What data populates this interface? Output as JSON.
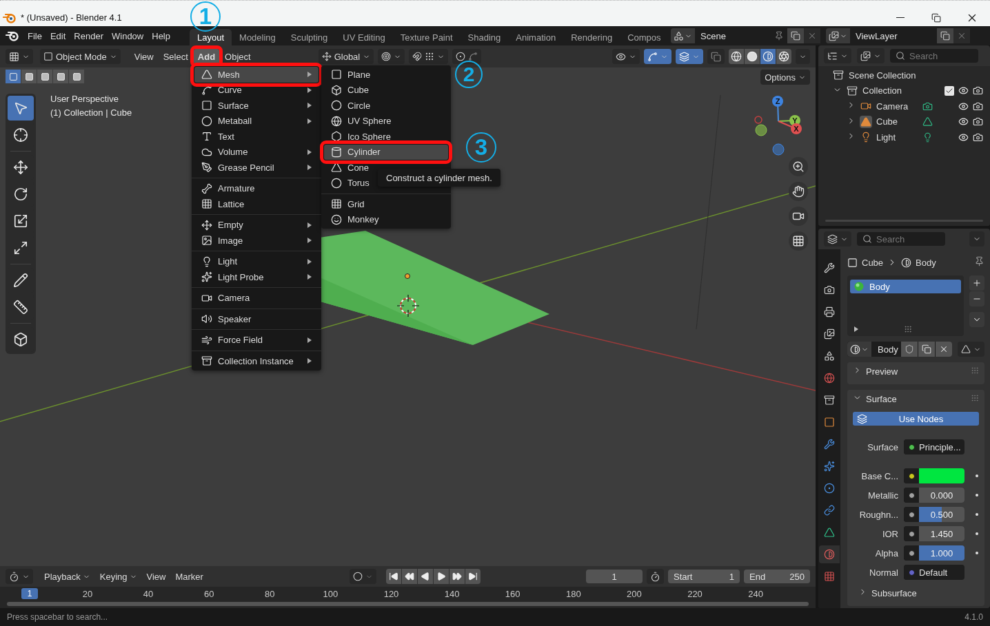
{
  "window": {
    "title": "* (Unsaved) - Blender 4.1"
  },
  "menubar": [
    "File",
    "Edit",
    "Render",
    "Window",
    "Help"
  ],
  "workspaces": [
    {
      "label": "Layout",
      "selected": true
    },
    {
      "label": "Modeling",
      "selected": false
    },
    {
      "label": "Sculpting",
      "selected": false
    },
    {
      "label": "UV Editing",
      "selected": false
    },
    {
      "label": "Texture Paint",
      "selected": false
    },
    {
      "label": "Shading",
      "selected": false
    },
    {
      "label": "Animation",
      "selected": false
    },
    {
      "label": "Rendering",
      "selected": false
    },
    {
      "label": "Compos",
      "selected": false
    }
  ],
  "scene": {
    "name": "Scene"
  },
  "view_layer": {
    "name": "ViewLayer"
  },
  "viewport": {
    "header": {
      "mode": "Object Mode",
      "menus": [
        {
          "label": "View",
          "selected": false,
          "highlighted": false
        },
        {
          "label": "Select",
          "selected": false,
          "highlighted": false
        },
        {
          "label": "Add",
          "selected": true,
          "highlighted": true
        },
        {
          "label": "Object",
          "selected": false,
          "highlighted": false
        }
      ],
      "orientation": "Global",
      "toggles": [
        {
          "kind": "gizmo",
          "on": true
        },
        {
          "kind": "overlay",
          "on": true
        },
        {
          "kind": "xray",
          "on": false
        }
      ],
      "shading_modes": [
        {
          "kind": "wireframe",
          "selected": false
        },
        {
          "kind": "solid",
          "selected": false
        },
        {
          "kind": "material",
          "selected": true
        },
        {
          "kind": "rendered",
          "selected": false
        }
      ],
      "options": "Options"
    },
    "select_modes": [
      {
        "selected": true
      },
      {
        "selected": false
      },
      {
        "selected": false
      },
      {
        "selected": false
      },
      {
        "selected": false
      }
    ],
    "tools": [
      {
        "kind": "select",
        "selected": true
      },
      {
        "kind": "cursor",
        "selected": false
      },
      {
        "kind": "move",
        "selected": false
      },
      {
        "kind": "rotate",
        "selected": false
      },
      {
        "kind": "scale",
        "selected": false
      },
      {
        "kind": "transform",
        "selected": false
      },
      {
        "kind": "annotate",
        "selected": false
      },
      {
        "kind": "measure",
        "selected": false
      },
      {
        "kind": "add_cube",
        "selected": false
      }
    ],
    "info": [
      "User Perspective",
      "(1) Collection | Cube"
    ],
    "gizmo_axes": [
      "Z",
      "Y",
      "X"
    ]
  },
  "add_menu": {
    "sections": [
      {
        "items": [
          {
            "label": "Mesh",
            "kind": "mesh",
            "submenu": true,
            "selected": true,
            "highlighted": true
          },
          {
            "label": "Curve",
            "kind": "curve",
            "submenu": true,
            "selected": false
          },
          {
            "label": "Surface",
            "kind": "surface",
            "submenu": true,
            "selected": false
          },
          {
            "label": "Metaball",
            "kind": "metaball",
            "submenu": true,
            "selected": false
          },
          {
            "label": "Text",
            "kind": "text",
            "submenu": false,
            "selected": false
          },
          {
            "label": "Volume",
            "kind": "volume",
            "submenu": true,
            "selected": false
          },
          {
            "label": "Grease Pencil",
            "kind": "grease_pencil",
            "submenu": true,
            "selected": false
          }
        ]
      },
      {
        "items": [
          {
            "label": "Armature",
            "kind": "armature",
            "submenu": false,
            "selected": false
          },
          {
            "label": "Lattice",
            "kind": "lattice",
            "submenu": false,
            "selected": false
          }
        ]
      },
      {
        "items": [
          {
            "label": "Empty",
            "kind": "empty",
            "submenu": true,
            "selected": false
          },
          {
            "label": "Image",
            "kind": "image",
            "submenu": true,
            "selected": false
          }
        ]
      },
      {
        "items": [
          {
            "label": "Light",
            "kind": "light",
            "submenu": true,
            "selected": false
          },
          {
            "label": "Light Probe",
            "kind": "light_probe",
            "submenu": true,
            "selected": false
          }
        ]
      },
      {
        "items": [
          {
            "label": "Camera",
            "kind": "camera",
            "submenu": false,
            "selected": false
          }
        ]
      },
      {
        "items": [
          {
            "label": "Speaker",
            "kind": "speaker",
            "submenu": false,
            "selected": false
          }
        ]
      },
      {
        "items": [
          {
            "label": "Force Field",
            "kind": "force_field",
            "submenu": true,
            "selected": false
          }
        ]
      },
      {
        "items": [
          {
            "label": "Collection Instance",
            "kind": "collection_instance",
            "submenu": true,
            "selected": false
          }
        ]
      }
    ]
  },
  "mesh_menu": {
    "sections": [
      {
        "items": [
          {
            "label": "Plane",
            "kind": "plane",
            "selected": false
          },
          {
            "label": "Cube",
            "kind": "cube",
            "selected": false
          },
          {
            "label": "Circle",
            "kind": "circle",
            "selected": false
          },
          {
            "label": "UV Sphere",
            "kind": "uv_sphere",
            "selected": false
          },
          {
            "label": "Ico Sphere",
            "kind": "ico_sphere",
            "selected": false
          },
          {
            "label": "Cylinder",
            "kind": "cylinder",
            "selected": true,
            "highlighted": true
          },
          {
            "label": "Cone",
            "kind": "cone",
            "selected": false
          },
          {
            "label": "Torus",
            "kind": "torus",
            "selected": false
          }
        ]
      },
      {
        "items": [
          {
            "label": "Grid",
            "kind": "grid",
            "selected": false
          },
          {
            "label": "Monkey",
            "kind": "monkey",
            "selected": false
          }
        ]
      }
    ]
  },
  "tooltip": "Construct a cylinder mesh.",
  "annotations": [
    {
      "label": "1"
    },
    {
      "label": "2"
    },
    {
      "label": "3"
    }
  ],
  "outliner": {
    "search_placeholder": "Search",
    "tree": [
      {
        "label": "Scene Collection",
        "kind": "scene_collection",
        "children": [
          {
            "label": "Collection",
            "kind": "collection",
            "expanded": true,
            "checked": true,
            "children": [
              {
                "label": "Camera",
                "kind": "camera",
                "expanded": false,
                "selected": false
              },
              {
                "label": "Cube",
                "kind": "mesh",
                "expanded": false,
                "selected": true
              },
              {
                "label": "Light",
                "kind": "light",
                "expanded": false,
                "selected": false
              }
            ]
          }
        ]
      }
    ]
  },
  "properties": {
    "search_placeholder": "Search",
    "tabs": [
      {
        "kind": "tool",
        "selected": false
      },
      {
        "kind": "render",
        "selected": false
      },
      {
        "kind": "output",
        "selected": false
      },
      {
        "kind": "view_layer",
        "selected": false
      },
      {
        "kind": "scene",
        "selected": false
      },
      {
        "kind": "world",
        "selected": false
      },
      {
        "kind": "collection",
        "selected": false
      },
      {
        "kind": "object",
        "selected": false
      },
      {
        "kind": "modifiers",
        "selected": false
      },
      {
        "kind": "particles",
        "selected": false
      },
      {
        "kind": "physics",
        "selected": false
      },
      {
        "kind": "constraints",
        "selected": false
      },
      {
        "kind": "data",
        "selected": false
      },
      {
        "kind": "material",
        "selected": true
      },
      {
        "kind": "texture",
        "selected": false
      }
    ],
    "breadcrumb": [
      "Cube",
      "Body"
    ],
    "slots": [
      {
        "label": "Body",
        "selected": true
      }
    ],
    "material": "Body",
    "panels": [
      {
        "title": "Preview",
        "expanded": false
      },
      {
        "title": "Surface",
        "expanded": true,
        "button": "Use Nodes",
        "rows": [
          {
            "kind": "link",
            "label": "Surface",
            "color": "#4fbf4f",
            "value": "Principle..."
          },
          {
            "kind": "color",
            "label": "Base C...",
            "color": "#c8c81e",
            "swatch": {
              "color": "#00e640"
            }
          },
          {
            "kind": "slider",
            "label": "Metallic",
            "color": "#a0a0a0",
            "value": "0.000",
            "level": 0
          },
          {
            "kind": "slider",
            "label": "Roughn...",
            "color": "#a0a0a0",
            "value": "0.500",
            "level": 0.5
          },
          {
            "kind": "slider",
            "label": "IOR",
            "color": "#a0a0a0",
            "value": "1.450",
            "level": 0
          },
          {
            "kind": "slider",
            "label": "Alpha",
            "color": "#a0a0a0",
            "value": "1.000",
            "level": 1
          },
          {
            "kind": "link",
            "label": "Normal",
            "color": "#6363c7",
            "value": "Default"
          }
        ],
        "subpanels": [
          {
            "title": "Subsurface",
            "expanded": false
          }
        ]
      }
    ]
  },
  "timeline": {
    "menus": [
      {
        "label": "Playback",
        "dropdown": true
      },
      {
        "label": "Keying",
        "dropdown": true
      },
      {
        "label": "View",
        "dropdown": false
      },
      {
        "label": "Marker",
        "dropdown": false
      }
    ],
    "current_frame": "1",
    "start_label": "Start",
    "start": "1",
    "end_label": "End",
    "end": "250",
    "ruler_current": "1",
    "ruler_ticks": [
      "20",
      "40",
      "60",
      "80",
      "100",
      "120",
      "140",
      "160",
      "180",
      "200",
      "220",
      "240"
    ]
  },
  "status_bar": {
    "hint": "Press spacebar to search...",
    "version": "4.1.0"
  }
}
